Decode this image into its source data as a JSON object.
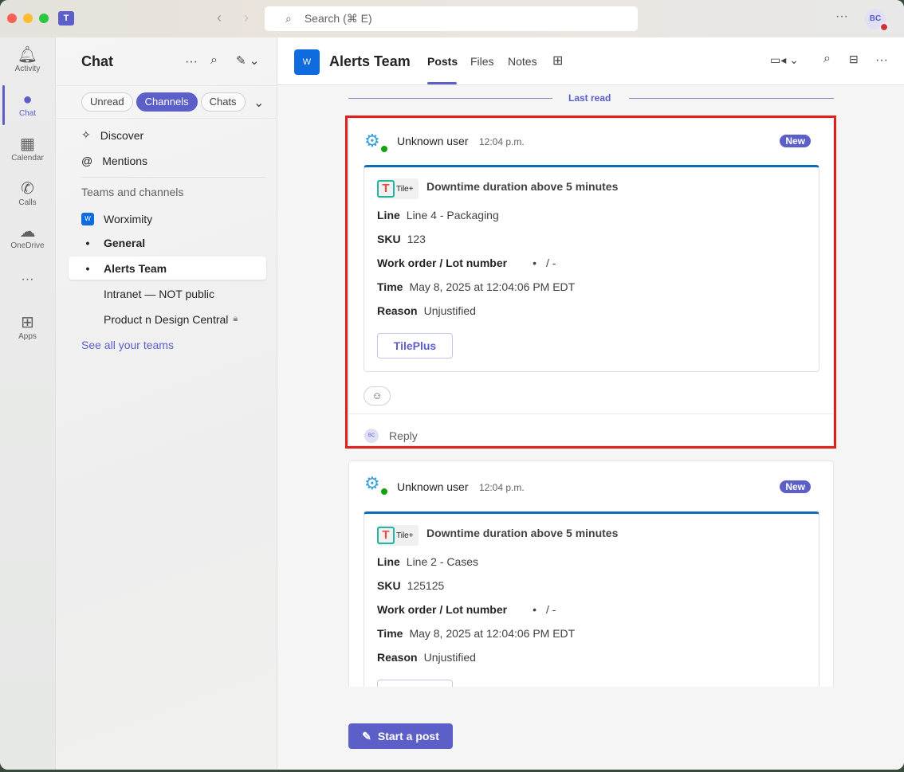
{
  "titlebar": {
    "search_placeholder": "Search (⌘ E)",
    "user_initials": "BC"
  },
  "rail": [
    {
      "label": "Activity",
      "icon": "bell-icon"
    },
    {
      "label": "Chat",
      "icon": "chat-icon"
    },
    {
      "label": "Calendar",
      "icon": "calendar-icon"
    },
    {
      "label": "Calls",
      "icon": "phone-icon"
    },
    {
      "label": "OneDrive",
      "icon": "cloud-icon"
    },
    {
      "label": "Apps",
      "icon": "plus-square-icon"
    }
  ],
  "sidebar": {
    "title": "Chat",
    "filters": [
      "Unread",
      "Channels",
      "Chats"
    ],
    "discover": "Discover",
    "mentions": "Mentions",
    "section": "Teams and channels",
    "team": "Worximity",
    "team_initial": "W",
    "channels": [
      "General",
      "Alerts Team",
      "Intranet — NOT public",
      "Product n Design Central"
    ],
    "see_all": "See all your teams"
  },
  "header": {
    "team_initial": "W",
    "title": "Alerts Team",
    "tabs": [
      "Posts",
      "Files",
      "Notes"
    ]
  },
  "feed": {
    "last_read": "Last read",
    "reply": "Reply",
    "reply_initials": "BC",
    "start_post": "Start a post",
    "posts": [
      {
        "author": "Unknown user",
        "time": "12:04 p.m.",
        "badge": "New",
        "app_label": "Tile+",
        "title": "Downtime duration above 5 minutes",
        "line_label": "Line",
        "line": "Line 4 - Packaging",
        "sku_label": "SKU",
        "sku": "123",
        "wo_label": "Work order / Lot number",
        "wo": "/ -",
        "time_label": "Time",
        "time_value": "May 8, 2025 at 12:04:06 PM EDT",
        "reason_label": "Reason",
        "reason": "Unjustified",
        "button": "TilePlus"
      },
      {
        "author": "Unknown user",
        "time": "12:04 p.m.",
        "badge": "New",
        "app_label": "Tile+",
        "title": "Downtime duration above 5 minutes",
        "line_label": "Line",
        "line": "Line 2 - Cases",
        "sku_label": "SKU",
        "sku": "125125",
        "wo_label": "Work order / Lot number",
        "wo": "/ -",
        "time_label": "Time",
        "time_value": "May 8, 2025 at 12:04:06 PM EDT",
        "reason_label": "Reason",
        "reason": "Unjustified"
      }
    ]
  },
  "colors": {
    "accent": "#5b5fc7",
    "highlight": "#e0201b",
    "card_top": "#0f6cbd"
  }
}
